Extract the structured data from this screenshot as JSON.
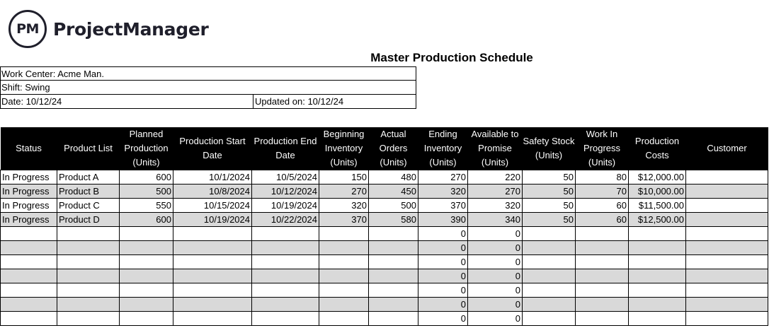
{
  "logo": {
    "badge": "PM",
    "name": "ProjectManager"
  },
  "title": "Master Production Schedule",
  "info": {
    "work_center": "Work Center: Acme Man.",
    "shift": "Shift: Swing",
    "date": "Date: 10/12/24",
    "updated": "Updated on: 10/12/24"
  },
  "headers": [
    "Status",
    "Product List",
    "Planned Production (Units)",
    "Production Start Date",
    "Production End Date",
    "Beginning Inventory (Units)",
    "Actual Orders (Units)",
    "Ending Inventory (Units)",
    "Available to Promise (Units)",
    "Safety Stock (Units)",
    "Work In Progress (Units)",
    "Production Costs",
    "Customer"
  ],
  "rows": [
    [
      "In Progress",
      "Product A",
      "600",
      "10/1/2024",
      "10/5/2024",
      "150",
      "480",
      "270",
      "220",
      "50",
      "80",
      "$12,000.00",
      ""
    ],
    [
      "In Progress",
      "Product B",
      "500",
      "10/8/2024",
      "10/12/2024",
      "270",
      "450",
      "320",
      "270",
      "50",
      "70",
      "$10,000.00",
      ""
    ],
    [
      "In Progress",
      "Product C",
      "550",
      "10/15/2024",
      "10/19/2024",
      "320",
      "500",
      "370",
      "320",
      "50",
      "60",
      "$11,500.00",
      ""
    ],
    [
      "In Progress",
      "Product D",
      "600",
      "10/19/2024",
      "10/22/2024",
      "370",
      "580",
      "390",
      "340",
      "50",
      "60",
      "$12,500.00",
      ""
    ],
    [
      "",
      "",
      "",
      "",
      "",
      "",
      "",
      "0",
      "0",
      "",
      "",
      "",
      ""
    ],
    [
      "",
      "",
      "",
      "",
      "",
      "",
      "",
      "0",
      "0",
      "",
      "",
      "",
      ""
    ],
    [
      "",
      "",
      "",
      "",
      "",
      "",
      "",
      "0",
      "0",
      "",
      "",
      "",
      ""
    ],
    [
      "",
      "",
      "",
      "",
      "",
      "",
      "",
      "0",
      "0",
      "",
      "",
      "",
      ""
    ],
    [
      "",
      "",
      "",
      "",
      "",
      "",
      "",
      "0",
      "0",
      "",
      "",
      "",
      ""
    ],
    [
      "",
      "",
      "",
      "",
      "",
      "",
      "",
      "0",
      "0",
      "",
      "",
      "",
      ""
    ],
    [
      "",
      "",
      "",
      "",
      "",
      "",
      "",
      "0",
      "0",
      "",
      "",
      "",
      ""
    ]
  ]
}
